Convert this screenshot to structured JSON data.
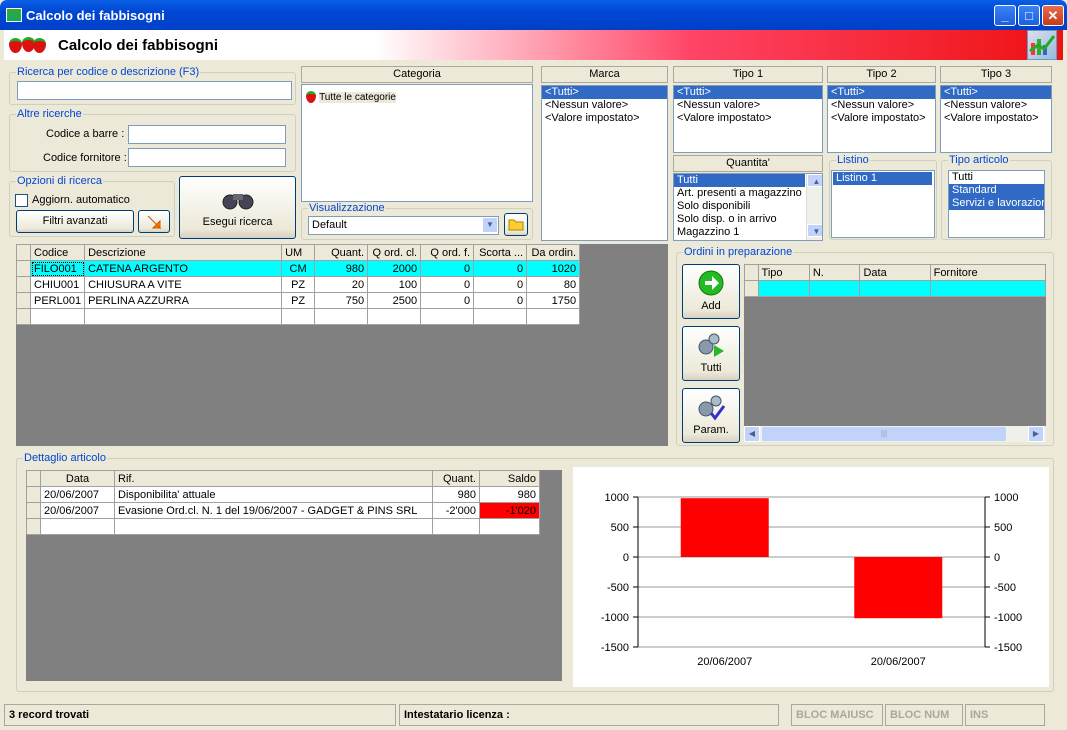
{
  "window": {
    "title": "Calcolo dei fabbisogni"
  },
  "header": {
    "title": "Calcolo dei fabbisogni"
  },
  "search": {
    "group_label": "Ricerca per codice o descrizione (F3)",
    "value": ""
  },
  "other_search": {
    "group_label": "Altre ricerche",
    "barcode_label": "Codice a barre :",
    "barcode_value": "",
    "supplier_label": "Codice fornitore :",
    "supplier_value": ""
  },
  "options": {
    "group_label": "Opzioni di ricerca",
    "auto_update_label": "Aggiorn. automatico",
    "advanced_filters_label": "Filtri avanzati"
  },
  "run_search": {
    "label": "Esegui ricerca"
  },
  "categoria": {
    "header": "Categoria",
    "items": [
      "Tutte le categorie"
    ]
  },
  "visualizzazione": {
    "group_label": "Visualizzazione",
    "value": "Default"
  },
  "marca": {
    "header": "Marca",
    "items": [
      "<Tutti>",
      "<Nessun valore>",
      "<Valore impostato>"
    ]
  },
  "tipo1": {
    "header": "Tipo 1",
    "items": [
      "<Tutti>",
      "<Nessun valore>",
      "<Valore impostato>"
    ]
  },
  "tipo2": {
    "header": "Tipo 2",
    "items": [
      "<Tutti>",
      "<Nessun valore>",
      "<Valore impostato>"
    ]
  },
  "tipo3": {
    "header": "Tipo 3",
    "items": [
      "<Tutti>",
      "<Nessun valore>",
      "<Valore impostato>"
    ]
  },
  "quantita": {
    "header": "Quantita'",
    "items": [
      "Tutti",
      "Art. presenti a magazzino",
      "Solo disponibili",
      "Solo disp. o in arrivo",
      "Magazzino 1"
    ]
  },
  "listino": {
    "group_label": "Listino",
    "items": [
      "Listino 1"
    ]
  },
  "tipo_articolo": {
    "group_label": "Tipo articolo",
    "items": [
      "Tutti",
      "Standard",
      "Servizi e lavorazione"
    ]
  },
  "main_table": {
    "columns": [
      "Codice",
      "Descrizione",
      "UM",
      "Quant.",
      "Q ord. cl.",
      "Q ord. f.",
      "Scorta ...",
      "Da ordin."
    ],
    "rows": [
      [
        "FILO001",
        "CATENA ARGENTO",
        "CM",
        "980",
        "2000",
        "0",
        "0",
        "1020"
      ],
      [
        "CHIU001",
        "CHIUSURA A VITE",
        "PZ",
        "20",
        "100",
        "0",
        "0",
        "80"
      ],
      [
        "PERL001",
        "PERLINA AZZURRA",
        "PZ",
        "750",
        "2500",
        "0",
        "0",
        "1750"
      ]
    ]
  },
  "orders": {
    "group_label": "Ordini in preparazione",
    "add_label": "Add",
    "all_label": "Tutti",
    "param_label": "Param.",
    "columns": [
      "Tipo",
      "N.",
      "Data",
      "Fornitore"
    ]
  },
  "detail": {
    "group_label": "Dettaglio articolo",
    "columns": [
      "Data",
      "Rif.",
      "Quant.",
      "Saldo"
    ],
    "rows": [
      [
        "20/06/2007",
        "Disponibilita' attuale",
        "980",
        "980"
      ],
      [
        "20/06/2007",
        "Evasione Ord.cl. N. 1 del 19/06/2007 - GADGET & PINS SRL",
        "-2'000",
        "-1'020"
      ]
    ]
  },
  "chart_data": {
    "type": "bar",
    "categories": [
      "20/06/2007",
      "20/06/2007"
    ],
    "values": [
      980,
      -1020
    ],
    "yticks": [
      1000,
      500,
      0,
      -500,
      -1000,
      -1500
    ],
    "ylim": [
      -1500,
      1000
    ],
    "bar_color": "#ff0000",
    "grid": true
  },
  "status": {
    "records": "3 record trovati",
    "license": "Intestatario licenza :",
    "caps": "BLOC MAIUSC",
    "num": "BLOC NUM",
    "ins": "INS"
  },
  "colors": {
    "selection": "#316ac5",
    "highlight_row": "#00ffff",
    "negative": "#ff0000"
  }
}
